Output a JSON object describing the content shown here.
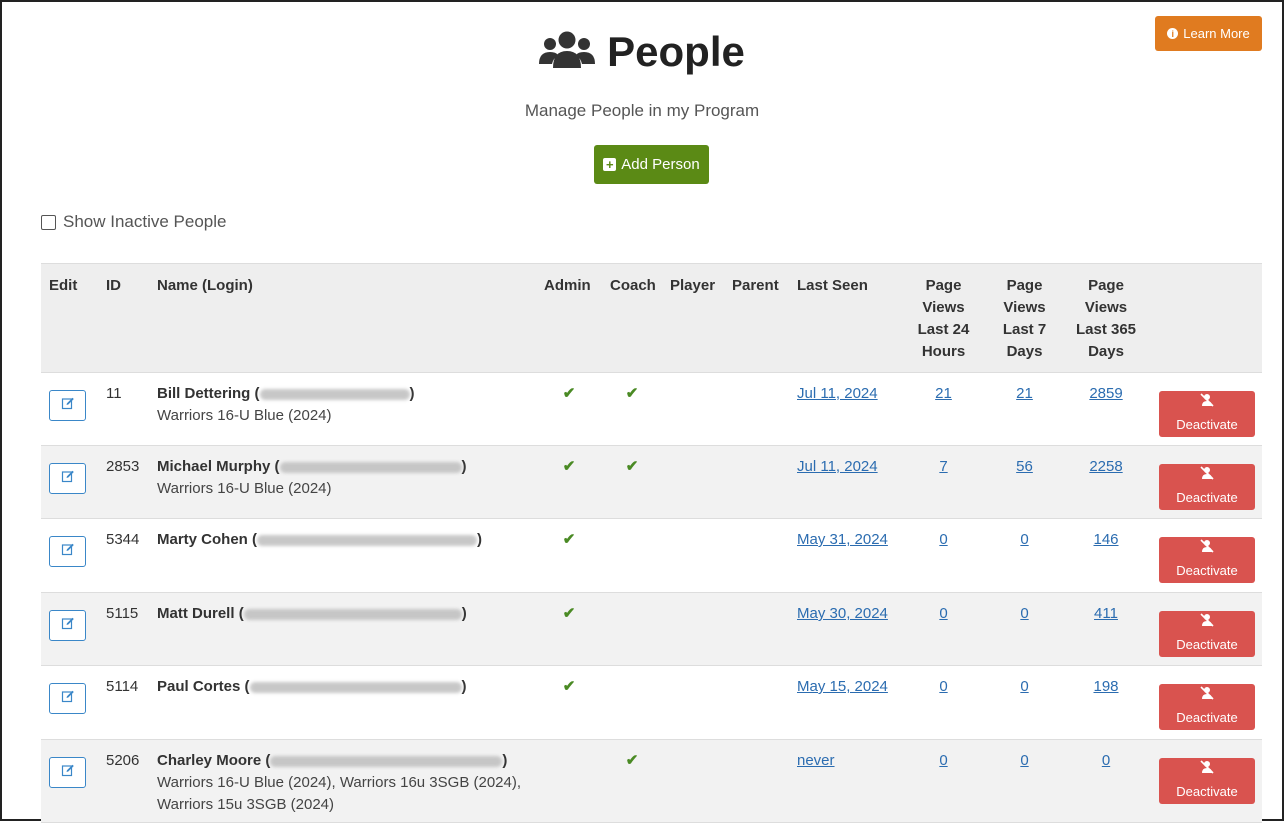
{
  "header": {
    "learn_more_label": "Learn More",
    "learn_more_icon": "info-icon",
    "title": "People",
    "title_icon": "users-icon",
    "subtitle": "Manage People in my Program",
    "add_person_label": "Add Person",
    "show_inactive_label": "Show Inactive People"
  },
  "colors": {
    "learn_more": "#e07b20",
    "add_person": "#5b8a15",
    "deactivate": "#d9534f",
    "link": "#2b6cb0",
    "check": "#4a8a24"
  },
  "table": {
    "headers": {
      "edit": "Edit",
      "id": "ID",
      "name": "Name (Login)",
      "admin": "Admin",
      "coach": "Coach",
      "player": "Player",
      "parent": "Parent",
      "last_seen": "Last Seen",
      "pv24": [
        "Page",
        "Views",
        "Last 24",
        "Hours"
      ],
      "pv7": [
        "Page",
        "Views",
        "Last 7",
        "Days"
      ],
      "pv365": [
        "Page",
        "Views",
        "Last 365",
        "Days"
      ]
    },
    "deactivate_label": "Deactivate",
    "rows": [
      {
        "id": "11",
        "name": "Bill Dettering",
        "teams": [
          "Warriors 16-U Blue (2024)"
        ],
        "admin": true,
        "coach": true,
        "player": false,
        "parent": false,
        "last_seen": "Jul 11, 2024",
        "pv24": "21",
        "pv7": "21",
        "pv365": "2859"
      },
      {
        "id": "2853",
        "name": "Michael Murphy",
        "teams": [
          "Warriors 16-U Blue (2024)"
        ],
        "admin": true,
        "coach": true,
        "player": false,
        "parent": false,
        "last_seen": "Jul 11, 2024",
        "pv24": "7",
        "pv7": "56",
        "pv365": "2258"
      },
      {
        "id": "5344",
        "name": "Marty Cohen",
        "teams": [],
        "admin": true,
        "coach": false,
        "player": false,
        "parent": false,
        "last_seen": "May 31, 2024",
        "pv24": "0",
        "pv7": "0",
        "pv365": "146"
      },
      {
        "id": "5115",
        "name": "Matt Durell",
        "teams": [],
        "admin": true,
        "coach": false,
        "player": false,
        "parent": false,
        "last_seen": "May 30, 2024",
        "pv24": "0",
        "pv7": "0",
        "pv365": "411"
      },
      {
        "id": "5114",
        "name": "Paul Cortes",
        "teams": [],
        "admin": true,
        "coach": false,
        "player": false,
        "parent": false,
        "last_seen": "May 15, 2024",
        "pv24": "0",
        "pv7": "0",
        "pv365": "198"
      },
      {
        "id": "5206",
        "name": "Charley Moore",
        "teams": [
          "Warriors 16-U Blue (2024), Warriors 16u 3SGB (2024),",
          "Warriors 15u 3SGB (2024)"
        ],
        "admin": false,
        "coach": true,
        "player": false,
        "parent": false,
        "last_seen": "never",
        "pv24": "0",
        "pv7": "0",
        "pv365": "0"
      }
    ]
  }
}
